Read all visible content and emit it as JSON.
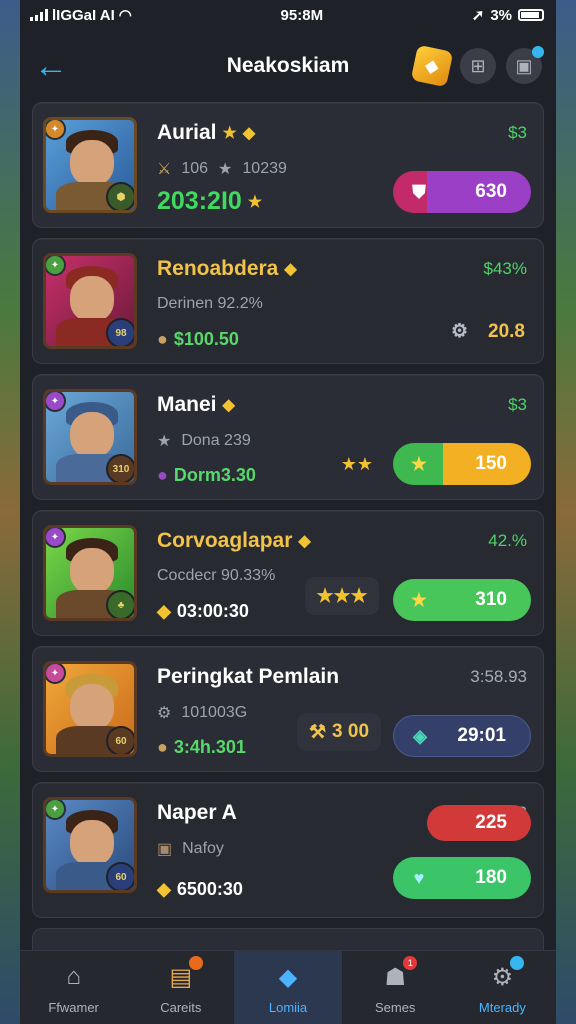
{
  "status": {
    "carrier": "lIGGaI AI",
    "time": "95:8M",
    "battery": "3%"
  },
  "header": {
    "title": "Neakoskiam"
  },
  "players": [
    {
      "name": "Aurial",
      "stat1": "106",
      "stat2": "10239",
      "score": "203:2I0",
      "top_value": "$3",
      "button": "630"
    },
    {
      "name": "Renoabdera",
      "sub": "Derinen 92.2%",
      "score": "$100.50",
      "top_value": "$43%",
      "stat_right": "20.8"
    },
    {
      "name": "Manei",
      "sub": "Dona 239",
      "score": "Dorm3.30",
      "top_value": "$3",
      "button": "150"
    },
    {
      "name": "Corvoaglapar",
      "sub": "Cocdecr 90.33%",
      "score": "03:00:30",
      "top_value": "42.%",
      "button": "310"
    },
    {
      "name": "Peringkat Pemlain",
      "sub": "101003G",
      "score": "3:4h.301",
      "top_value": "3:58.93",
      "stat_mid": "3 00",
      "button": "29:01"
    },
    {
      "name": "Naper A",
      "sub": "Nafoy",
      "score": "6500:30",
      "top_value": "*3",
      "button_top": "225",
      "button": "180"
    }
  ],
  "tabs": [
    {
      "label": "Ffwamer",
      "icon": "home-icon"
    },
    {
      "label": "Careits",
      "icon": "cards-icon"
    },
    {
      "label": "Lomiia",
      "icon": "leaderboard-icon"
    },
    {
      "label": "Semes",
      "icon": "profile-icon"
    },
    {
      "label": "Mterady",
      "icon": "settings-icon"
    }
  ],
  "colors": {
    "accent": "#3ab2f2",
    "card_bg": "#2a2d35",
    "score_green": "#3fda5e",
    "gold": "#f2c34a"
  }
}
